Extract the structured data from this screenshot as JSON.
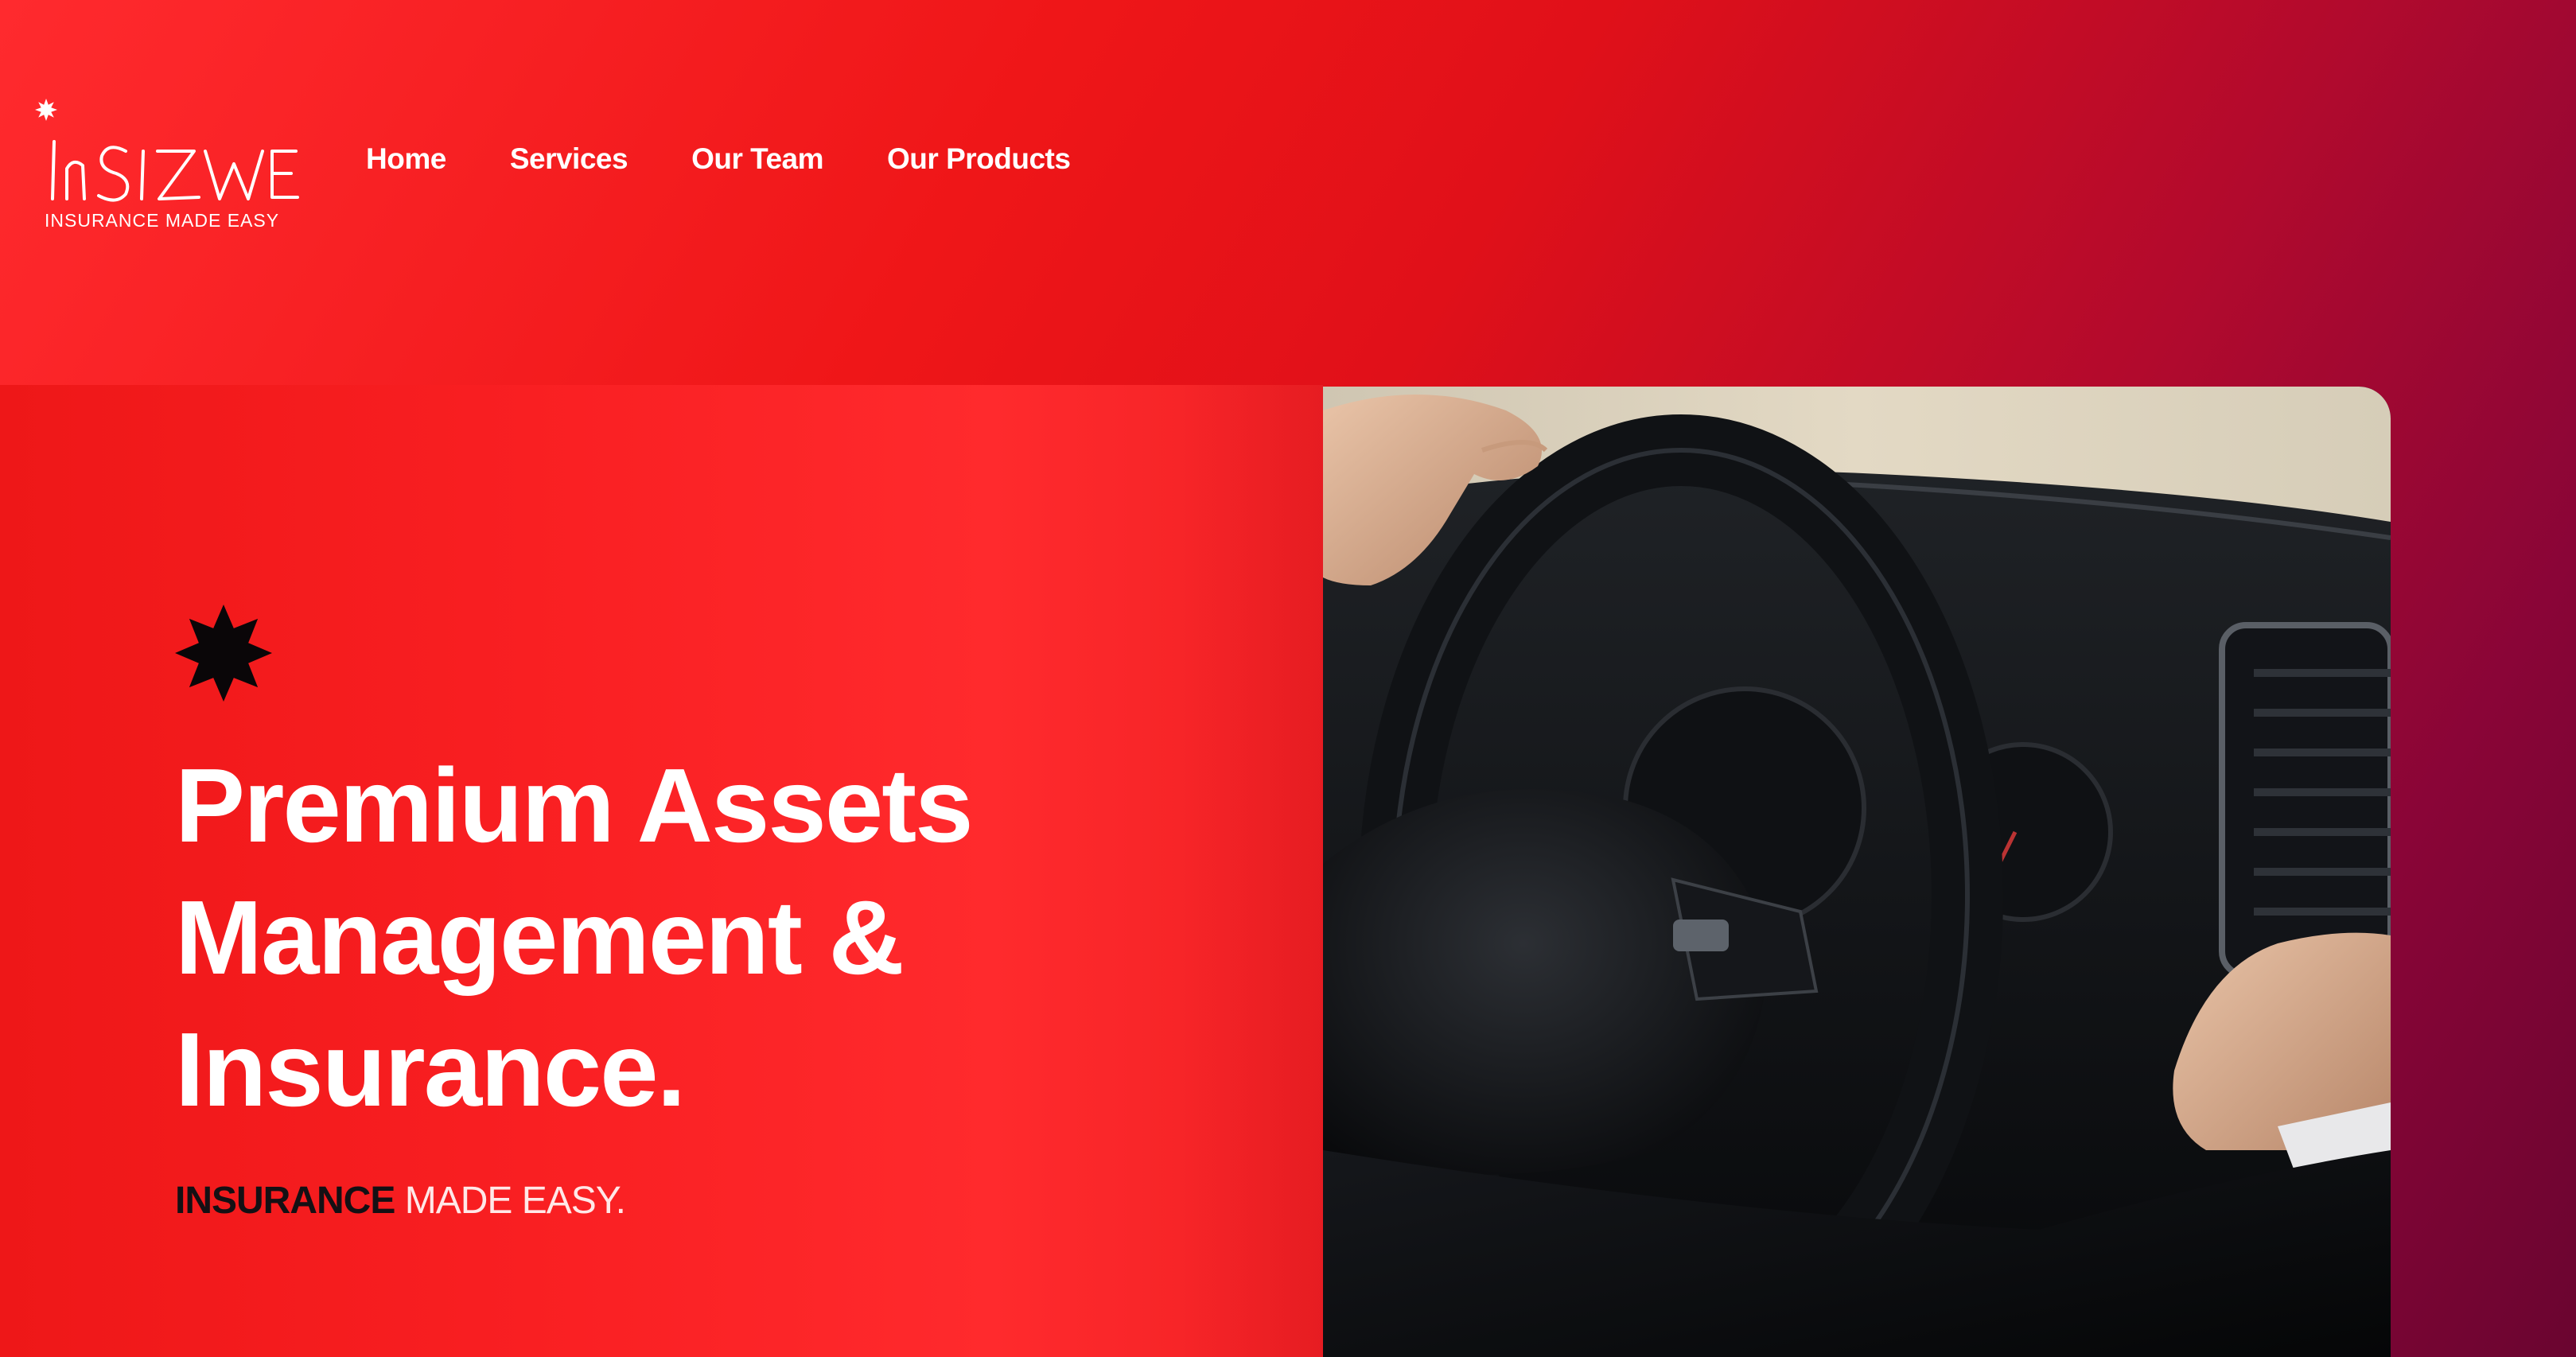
{
  "brand": {
    "logo_text": "INSIZWE",
    "tagline": "INSURANCE MADE EASY"
  },
  "nav": {
    "items": [
      {
        "label": "Home"
      },
      {
        "label": "Services"
      },
      {
        "label": "Our Team"
      },
      {
        "label": "Our Products"
      }
    ]
  },
  "hero": {
    "heading_lines": [
      "Premium Assets",
      "Management &",
      "Insurance."
    ],
    "tagline_strong": "INSURANCE",
    "tagline_light": "MADE EASY.",
    "star_icon": "eight-point-star-icon",
    "image_alt": "Hands on a car steering wheel"
  },
  "colors": {
    "brand_red": "#f91f22",
    "deep_red": "#e01019",
    "wine": "#6a0530",
    "white": "#ffffff",
    "ink": "#141014"
  }
}
